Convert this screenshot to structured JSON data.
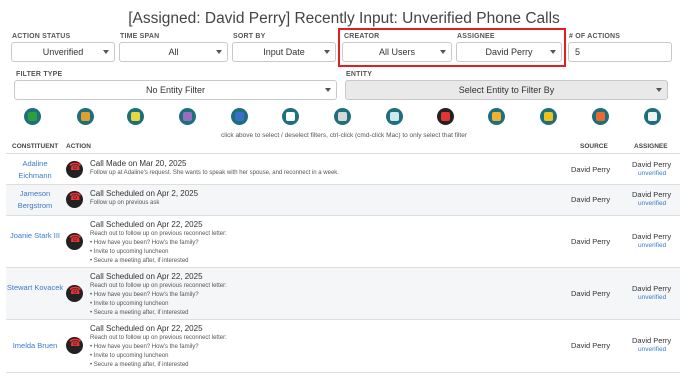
{
  "title": "[Assigned: David Perry] Recently Input: Unverified Phone Calls",
  "filters": {
    "action_status": {
      "label": "ACTION STATUS",
      "value": "Unverified"
    },
    "time_span": {
      "label": "TIME SPAN",
      "value": "All"
    },
    "sort_by": {
      "label": "SORT BY",
      "value": "Input Date"
    },
    "creator": {
      "label": "CREATOR",
      "value": "All Users"
    },
    "assignee": {
      "label": "ASSIGNEE",
      "value": "David Perry"
    },
    "num_actions": {
      "label": "# OF ACTIONS",
      "value": "5"
    },
    "filter_type": {
      "label": "FILTER TYPE",
      "value": "No Entity Filter"
    },
    "entity": {
      "label": "ENTITY",
      "value": "Select Entity to Filter By"
    }
  },
  "icon_bar": {
    "icons": [
      {
        "name": "green-square-icon",
        "color": "#2e9e3e"
      },
      {
        "name": "money-icon",
        "color": "#e0a030"
      },
      {
        "name": "ticket-icon",
        "color": "#e8d840"
      },
      {
        "name": "purple-square-icon",
        "color": "#9a6cc0"
      },
      {
        "name": "pencil-icon",
        "color": "#3a6ec8"
      },
      {
        "name": "paper-plane-icon",
        "color": "#ffffff"
      },
      {
        "name": "building-icon",
        "color": "#d8d8d8"
      },
      {
        "name": "globe-icon",
        "color": "#cfe8f0"
      },
      {
        "name": "phone-icon",
        "color": "#e33333"
      },
      {
        "name": "chat-icon",
        "color": "#f0b030"
      },
      {
        "name": "people-icon",
        "color": "#f0c020"
      },
      {
        "name": "arrow-icon",
        "color": "#e86a30"
      },
      {
        "name": "document-icon",
        "color": "#f0f0f0"
      }
    ],
    "hint": "click above to select / deselect filters, ctrl-click (cmd-click Mac) to only select that filter"
  },
  "table": {
    "headers": {
      "constituent": "CONSTITUENT",
      "action": "ACTION",
      "source": "SOURCE",
      "assignee": "ASSIGNEE"
    },
    "rows": [
      {
        "constituent": "Adaline Eichmann",
        "title": "Call Made on Mar 20, 2025",
        "lines": [
          "Follow up at Adaline's request. She wants to speak with her spouse, and reconnect in a week."
        ],
        "source": "David Perry",
        "assignee": "David Perry",
        "status": "unverified"
      },
      {
        "constituent": "Jameson Bergstrom",
        "title": "Call Scheduled on Apr 2, 2025",
        "lines": [
          "Follow up on previous ask"
        ],
        "source": "David Perry",
        "assignee": "David Perry",
        "status": "unverified"
      },
      {
        "constituent": "Joanie Stark III",
        "title": "Call Scheduled on Apr 22, 2025",
        "lines": [
          "Reach out to follow up on previous reconnect letter:",
          "• How have you been? How's the family?",
          "• Invite to upcoming luncheon",
          "• Secure a meeting after, if interested"
        ],
        "source": "David Perry",
        "assignee": "David Perry",
        "status": "unverified"
      },
      {
        "constituent": "Stewart Kovacek",
        "title": "Call Scheduled on Apr 22, 2025",
        "lines": [
          "Reach out to follow up on previous reconnect letter:",
          "• How have you been? How's the family?",
          "• Invite to upcoming luncheon",
          "• Secure a meeting after, if interested"
        ],
        "source": "David Perry",
        "assignee": "David Perry",
        "status": "unverified"
      },
      {
        "constituent": "Imelda Bruen",
        "title": "Call Scheduled on Apr 22, 2025",
        "lines": [
          "Reach out to follow up on previous reconnect letter:",
          "• How have you been? How's the family?",
          "• Invite to upcoming luncheon",
          "• Secure a meeting after, if interested"
        ],
        "source": "David Perry",
        "assignee": "David Perry",
        "status": "unverified"
      }
    ]
  }
}
